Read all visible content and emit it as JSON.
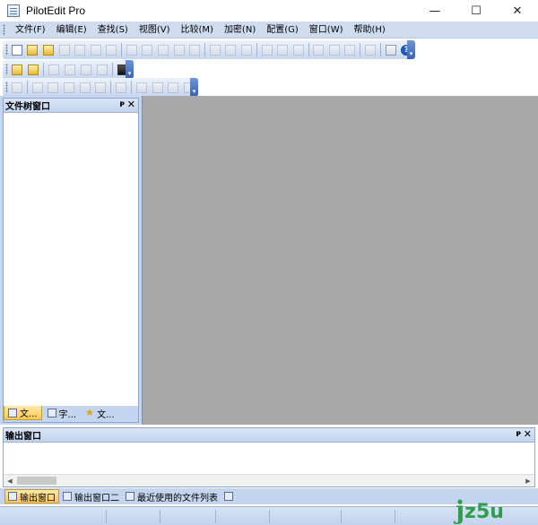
{
  "window": {
    "title": "PilotEdit Pro",
    "controls": {
      "minimize": "—",
      "maximize": "☐",
      "close": "✕"
    }
  },
  "menu": [
    "文件(F)",
    "编辑(E)",
    "查找(S)",
    "视图(V)",
    "比较(M)",
    "加密(N)",
    "配置(G)",
    "窗口(W)",
    "帮助(H)"
  ],
  "toolbar1": {
    "icons": [
      "new-file-icon",
      "open-file-icon",
      "open-folder-icon",
      "save-icon",
      "save-all-icon",
      "close-file-icon",
      "close-all-icon",
      "undo-icon",
      "redo-icon",
      "cut-icon",
      "copy-icon",
      "paste-icon",
      "copy-window-icon",
      "wrap-icon",
      "sort-icon",
      "indent-icon",
      "outdent-icon",
      "mark-icon",
      "find-icon",
      "find-next-icon",
      "replace-icon",
      "tools-icon",
      "monitor-icon",
      "help-icon"
    ],
    "help_glyph": "?"
  },
  "toolbar2": {
    "icons": [
      "encrypt-icon",
      "decrypt-icon",
      "align-left-icon",
      "align-right-icon",
      "format-icon",
      "format2-icon",
      "lock-icon"
    ]
  },
  "toolbar3": {
    "icons": [
      "macro-icon",
      "record-icon",
      "play-icon",
      "sort-az-icon",
      "move-up-icon",
      "list-icon",
      "options-icon",
      "column-icon",
      "zoom-in-icon",
      "zoom-out-icon",
      "fit-icon"
    ]
  },
  "left_pane": {
    "title": "文件树窗口",
    "pin": "ᴘ",
    "close": "✕",
    "tabs": [
      {
        "label": "文...",
        "icon": "file-tree-icon"
      },
      {
        "label": "字...",
        "icon": "chart-icon"
      },
      {
        "label": "文...",
        "icon": "star-icon"
      }
    ]
  },
  "output_pane": {
    "title": "输出窗口",
    "pin": "ᴘ",
    "close": "✕",
    "scroll_left": "◀",
    "scroll_right": "▶"
  },
  "bottom_tabs": [
    {
      "label": "输出窗口",
      "icon": "output-icon"
    },
    {
      "label": "输出窗口二",
      "icon": "output2-icon"
    },
    {
      "label": "最近使用的文件列表",
      "icon": "recent-files-icon"
    },
    {
      "label": "",
      "icon": "grid-icon"
    }
  ],
  "watermark": {
    "j": "j",
    "text": "z5u"
  },
  "colors": {
    "doc_area": "#a8a8a8",
    "frame": "#c3d5ef",
    "active_tab": "#ffc94e",
    "watermark": "#2e9e4a"
  }
}
